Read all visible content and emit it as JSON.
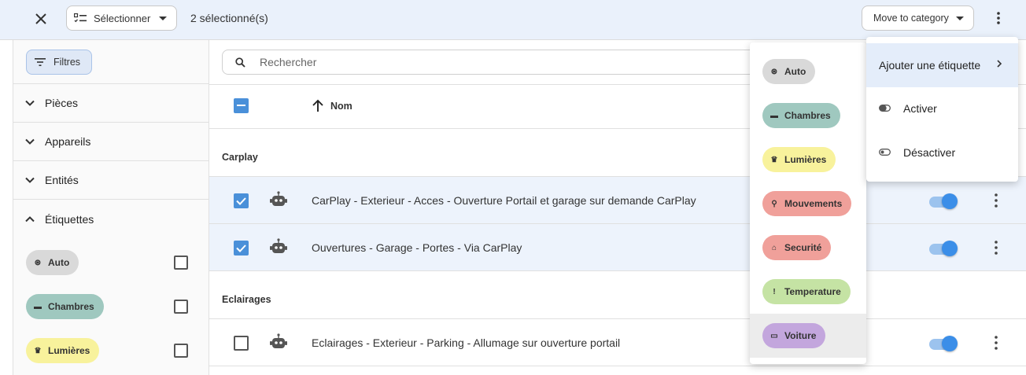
{
  "topbar": {
    "select_label": "Sélectionner",
    "selected_count": "2 sélectionné(s)",
    "move_label": "Move to category"
  },
  "sidebar": {
    "filters_label": "Filtres",
    "groups": [
      {
        "label": "Pièces",
        "expanded": false
      },
      {
        "label": "Appareils",
        "expanded": false
      },
      {
        "label": "Entités",
        "expanded": false
      },
      {
        "label": "Étiquettes",
        "expanded": true
      }
    ],
    "tags": [
      {
        "label": "Auto",
        "icon": "auto-icon",
        "color": "#d9d9d9"
      },
      {
        "label": "Chambres",
        "icon": "bed-icon",
        "color": "#9fc8bf"
      },
      {
        "label": "Lumières",
        "icon": "lights-icon",
        "color": "#f8f29c"
      }
    ]
  },
  "main": {
    "search_placeholder": "Rechercher",
    "column_name": "Nom",
    "sections": [
      {
        "title": "Carplay"
      },
      {
        "title": "Eclairages"
      }
    ],
    "rows": [
      {
        "name": "CarPlay - Exterieur - Acces - Ouverture Portail et garage sur demande CarPlay",
        "checked": true,
        "enabled": true
      },
      {
        "name": "Ouvertures - Garage - Portes - Via CarPlay",
        "checked": true,
        "enabled": true
      },
      {
        "name": "Eclairages - Exterieur - Parking - Allumage sur ouverture portail",
        "checked": false,
        "enabled": true
      }
    ]
  },
  "tags_menu": {
    "items": [
      {
        "label": "Auto",
        "icon": "auto-icon",
        "color": "#d9d9d9"
      },
      {
        "label": "Chambres",
        "icon": "bed-icon",
        "color": "#9fc8bf"
      },
      {
        "label": "Lumières",
        "icon": "lights-icon",
        "color": "#f8f29c"
      },
      {
        "label": "Mouvements",
        "icon": "walking-icon",
        "color": "#f0a09a"
      },
      {
        "label": "Securité",
        "icon": "home-icon",
        "color": "#f0a09a"
      },
      {
        "label": "Temperature",
        "icon": "thermometer-icon",
        "color": "#c5e3a4"
      },
      {
        "label": "Voiture",
        "icon": "car-icon",
        "color": "#c3a6dd"
      }
    ]
  },
  "context_menu": {
    "add_tag_label": "Ajouter une étiquette",
    "enable_label": "Activer",
    "disable_label": "Désactiver"
  },
  "colors": {
    "accent": "#4a90d9",
    "topbar_bg": "#eaf1fb",
    "toggle_on": "#3b8ee8"
  }
}
